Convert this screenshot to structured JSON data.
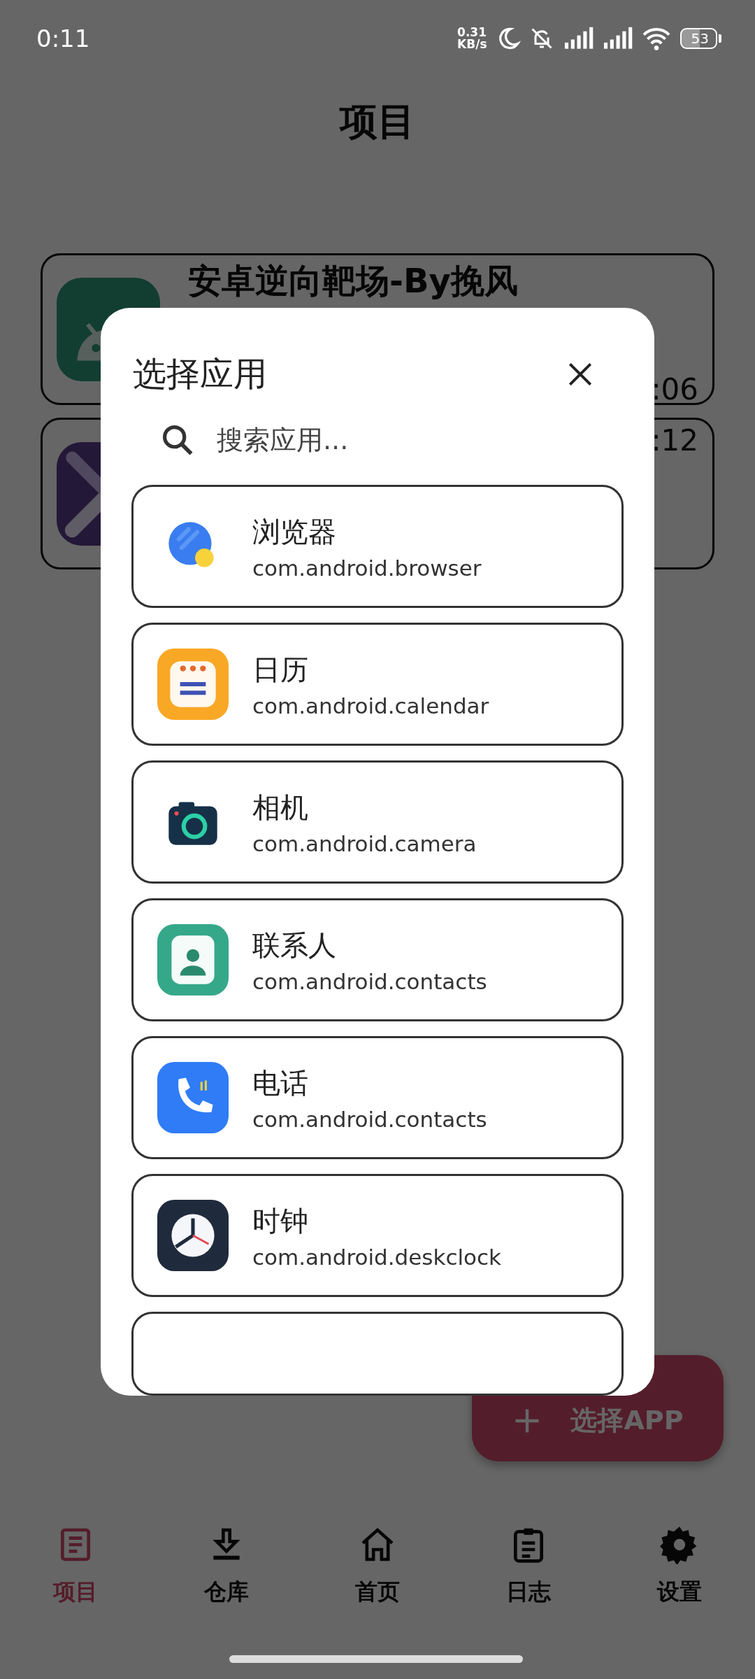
{
  "status_bar": {
    "time": "0:11",
    "net_speed": [
      "0.31",
      "KB/s"
    ],
    "battery": "53"
  },
  "page": {
    "title": "项目"
  },
  "projects": [
    {
      "title": "安卓逆向靶场-By挽风",
      "time": ":06",
      "kind": "android"
    },
    {
      "time": ":12",
      "kind": "tools"
    }
  ],
  "fab": {
    "label": "选择APP"
  },
  "nav": [
    {
      "label": "项目",
      "kind": "list",
      "selected": true
    },
    {
      "label": "仓库",
      "kind": "download",
      "selected": false
    },
    {
      "label": "首页",
      "kind": "home",
      "selected": false
    },
    {
      "label": "日志",
      "kind": "clipboard",
      "selected": false
    },
    {
      "label": "设置",
      "kind": "gear",
      "selected": false
    }
  ],
  "dialog": {
    "title": "选择应用",
    "search": {
      "placeholder": "搜索应用..."
    },
    "apps": [
      {
        "name": "浏览器",
        "package": "com.android.browser",
        "kind": "browser"
      },
      {
        "name": "日历",
        "package": "com.android.calendar",
        "kind": "calendar"
      },
      {
        "name": "相机",
        "package": "com.android.camera",
        "kind": "camera"
      },
      {
        "name": "联系人",
        "package": "com.android.contacts",
        "kind": "contacts"
      },
      {
        "name": "电话",
        "package": "com.android.contacts",
        "kind": "phone"
      },
      {
        "name": "时钟",
        "package": "com.android.deskclock",
        "kind": "clock"
      }
    ]
  }
}
